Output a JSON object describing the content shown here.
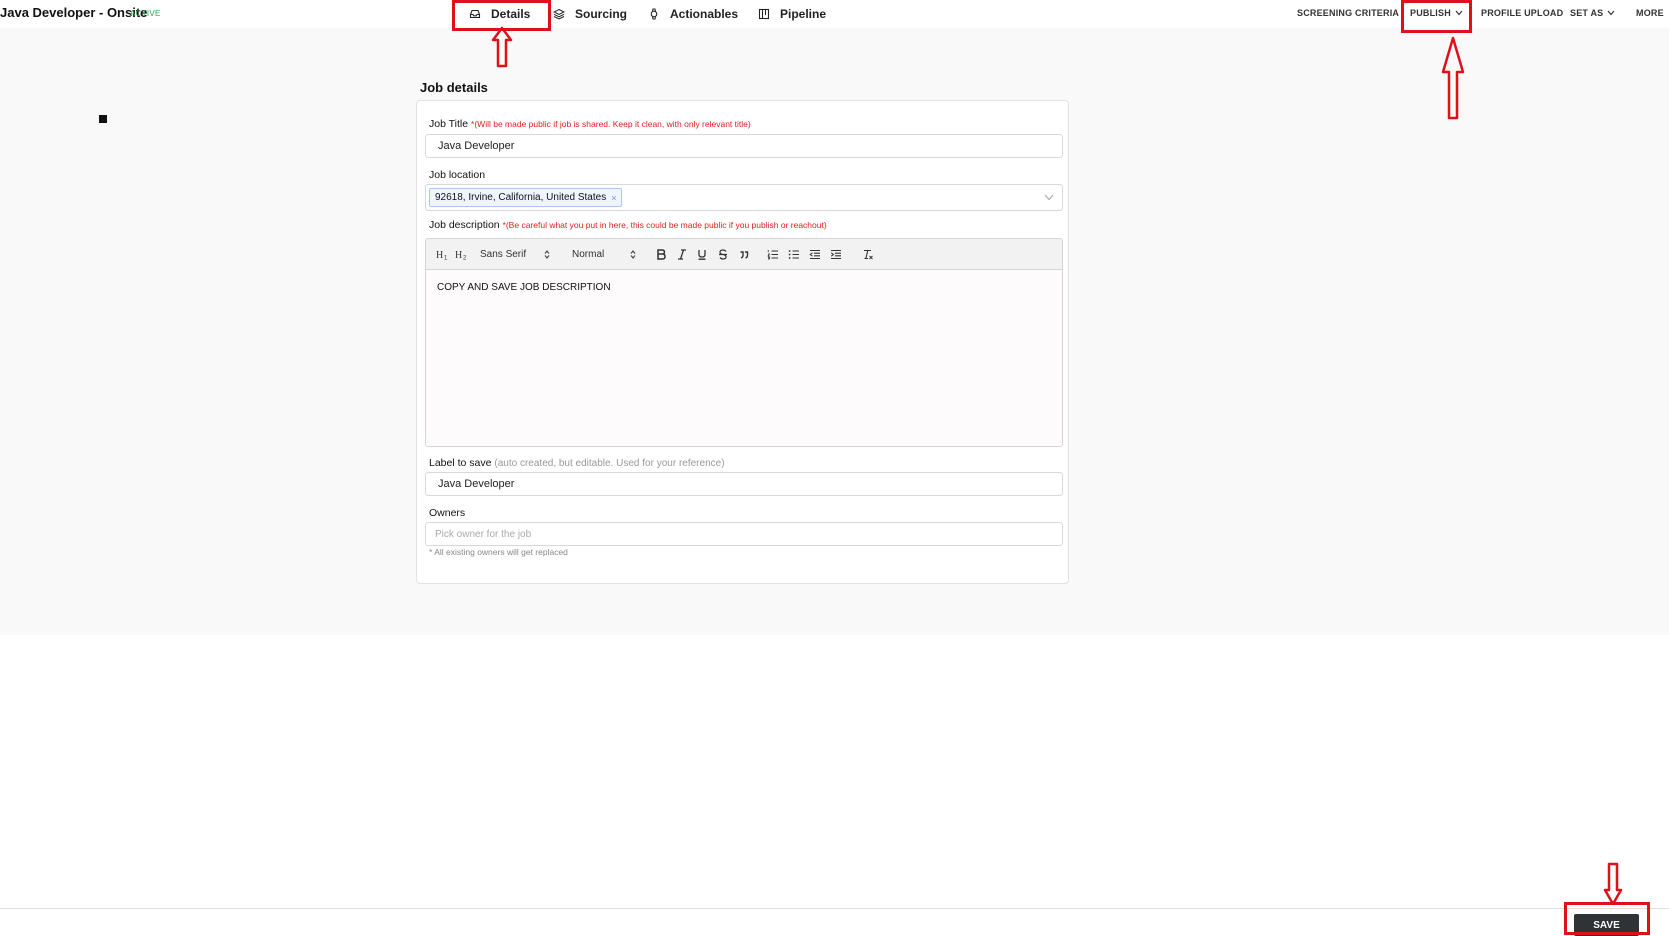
{
  "header": {
    "title": "Java Developer - Onsite",
    "status_badge": "ACTIVE",
    "tabs": [
      {
        "label": "Details",
        "icon": "inbox-icon"
      },
      {
        "label": "Sourcing",
        "icon": "layers-icon"
      },
      {
        "label": "Actionables",
        "icon": "watch-icon"
      },
      {
        "label": "Pipeline",
        "icon": "board-icon"
      }
    ],
    "right_menu": [
      {
        "label": "SCREENING CRITERIA"
      },
      {
        "label": "PUBLISH"
      },
      {
        "label": "PROFILE UPLOAD"
      },
      {
        "label": "SET AS"
      },
      {
        "label": "MORE"
      }
    ]
  },
  "job_details": {
    "section_title": "Job details",
    "job_title": {
      "label": "Job Title",
      "note": "*(Will be made public if job is shared. Keep it clean, with only relevant title)",
      "value": "Java Developer"
    },
    "job_location": {
      "label": "Job location",
      "chip": "92618, Irvine, California, United States",
      "chip_remove": "×"
    },
    "job_description": {
      "label": "Job description",
      "note": "*(Be careful what you put in here, this could be made public if you publish or reachout)",
      "toolbar": {
        "font": "Sans Serif",
        "size": "Normal"
      },
      "content": "COPY AND SAVE JOB DESCRIPTION"
    },
    "label_to_save": {
      "label": "Label to save",
      "hint": "(auto created, but editable. Used for your reference)",
      "value": "Java Developer"
    },
    "owners": {
      "label": "Owners",
      "placeholder": "Pick owner for the job",
      "helper": "* All existing owners will get replaced"
    }
  },
  "footer": {
    "save_label": "SAVE"
  },
  "colors": {
    "required": "#e02020",
    "badge": "#2fa84f",
    "annotation": "#e0101a",
    "save_button": "#2f3337"
  }
}
